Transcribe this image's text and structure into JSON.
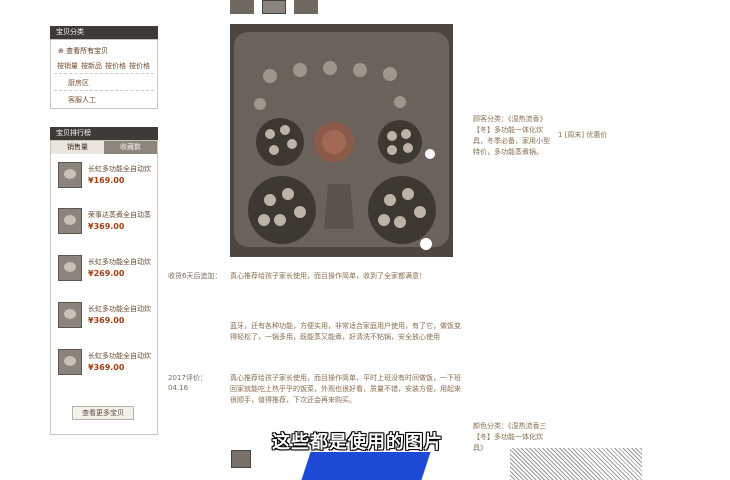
{
  "sidebar": {
    "category_title": "宝贝分类",
    "view_all": "查看所有宝贝",
    "category_links": [
      "按销量",
      "按新品",
      "按价格",
      "按价格"
    ],
    "categories": [
      "厨房区",
      "客服人工"
    ],
    "ranking_title": "宝贝排行榜",
    "ranking_tabs": [
      "销售量",
      "收藏数"
    ],
    "ranking_items": [
      {
        "name": "长虹多功能全自动炊",
        "price": "¥169.00"
      },
      {
        "name": "荣事达蒸煮全自动蒸",
        "price": "¥369.00"
      },
      {
        "name": "长虹多功能全自动炊",
        "price": "¥269.00"
      },
      {
        "name": "长虹多功能全自动炊",
        "price": "¥369.00"
      },
      {
        "name": "长虹多功能全自动炊",
        "price": "¥369.00"
      }
    ],
    "view_more_button": "查看更多宝贝"
  },
  "product": {
    "description_right": "顾客分类：《湿热流香》【冬】多功能一体化炊具，冬季必备，家用小型特价，多功能蒸煮锅。",
    "badge": "1 [周末] 优惠价",
    "review_label_1": "收货6天后追加：",
    "review_text_1": "真心推荐给孩子家长使用，而且操作简单，收到了全家都满意！",
    "review_block_2": "蓝牙，还有各种功能，方便实用，非常适合家庭用户使用，有了它，做饭变得轻松了，一锅多用，既能蒸又能煮，好清洗不粘锅，安全放心使用",
    "review_label_3": "2017评价：",
    "review_date_3": "04.16",
    "review_text_3": "真心推荐给孩子家长使用，而且操作简单，平时上班没有时间做饭，一下班回家就能吃上热乎乎的饭菜，外观也很好看，质量不错，安装方便，用起来很顺手，值得推荐，下次还会再来购买。",
    "side_text_bottom": "颜色分类：《湿热流香三【冬】多功能一体化炊具》"
  },
  "subtitle": "这些都是使用的图片"
}
